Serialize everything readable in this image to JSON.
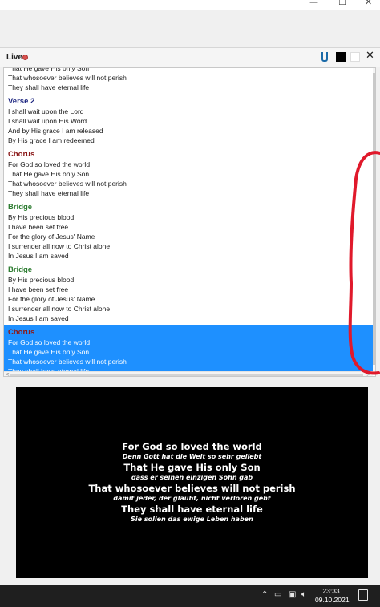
{
  "window": {
    "minimize_glyph": "—",
    "maximize_glyph": "☐",
    "close_glyph": "✕"
  },
  "live_panel": {
    "label": "Live",
    "status_color": "#d9534f",
    "icons": [
      "clip-icon",
      "black-screen-icon",
      "white-screen-icon",
      "close-icon"
    ],
    "close_glyph": "✕"
  },
  "slides": [
    {
      "title": "",
      "type": "chorus",
      "lines": [
        "That He gave His only Son",
        "That whosoever believes will not perish",
        "They shall have eternal life"
      ],
      "selected": false
    },
    {
      "title": "Verse 2",
      "type": "verse",
      "lines": [
        "I shall wait upon the Lord",
        "I shall wait upon His Word",
        "And by His grace I am released",
        "By His grace I am redeemed"
      ],
      "selected": false
    },
    {
      "title": "Chorus",
      "type": "chorus",
      "lines": [
        "For God so loved the world",
        "That He gave His only Son",
        "That whosoever believes will not perish",
        "They shall have eternal life"
      ],
      "selected": false
    },
    {
      "title": "Bridge",
      "type": "bridge",
      "lines": [
        "By His precious blood",
        "I have been set free",
        "For the glory of Jesus' Name",
        "I surrender all now to Christ alone",
        "In Jesus I am saved"
      ],
      "selected": false
    },
    {
      "title": "Bridge",
      "type": "bridge",
      "lines": [
        "By His precious blood",
        "I have been set free",
        "For the glory of Jesus' Name",
        "I surrender all now to Christ alone",
        "In Jesus I am saved"
      ],
      "selected": false
    },
    {
      "title": "Chorus",
      "type": "chorus",
      "lines": [
        "For God so loved the world",
        "That He gave His only Son",
        "That whosoever believes will not perish",
        "They shall have eternal life"
      ],
      "selected": true
    }
  ],
  "scroll": {
    "left_arrow": "<",
    "right_arrow": ">"
  },
  "preview": {
    "background": "#000000",
    "lines": [
      {
        "text": "For God so loved the world",
        "kind": "main"
      },
      {
        "text": "Denn Gott hat die Welt so sehr geliebt",
        "kind": "translation"
      },
      {
        "text": "That He gave His only Son",
        "kind": "main"
      },
      {
        "text": "dass er seinen einzigen Sohn gab",
        "kind": "translation"
      },
      {
        "text": "That whosoever believes will not perish",
        "kind": "main"
      },
      {
        "text": "damit jeder, der glaubt, nicht verloren geht",
        "kind": "translation"
      },
      {
        "text": "They shall have eternal life",
        "kind": "main"
      },
      {
        "text": "Sie sollen das ewige Leben haben",
        "kind": "translation"
      }
    ]
  },
  "taskbar": {
    "tray_icons": {
      "chevron": "⌃",
      "battery": "▭",
      "network": "▣",
      "volume": "🔈︎"
    },
    "time": "23:33",
    "date": "09.10.2021"
  }
}
